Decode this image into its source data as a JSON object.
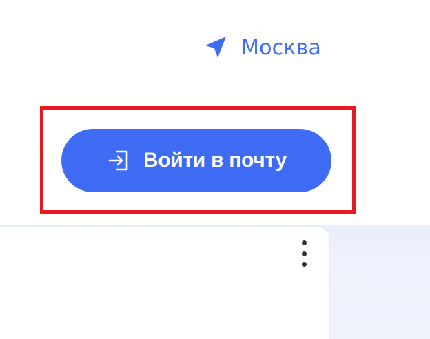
{
  "header": {
    "location": {
      "icon": "navigation-arrow-icon",
      "label": "Москва"
    }
  },
  "login": {
    "icon": "login-enter-icon",
    "label": "Войти в почту"
  },
  "card": {
    "menu_icon": "more-vertical-icon"
  },
  "colors": {
    "accent": "#3e6cf4",
    "location_text": "#3d6df5",
    "highlight_border": "#e51b24"
  }
}
